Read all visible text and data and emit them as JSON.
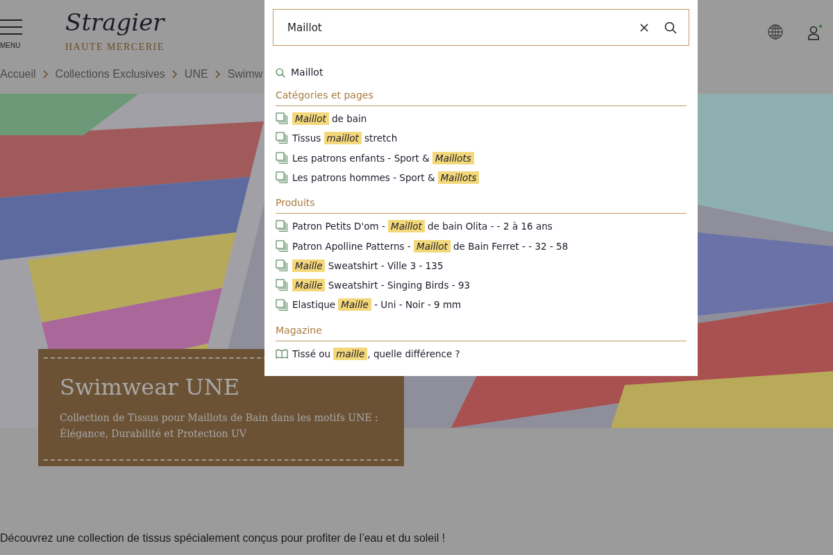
{
  "header": {
    "menu_label": "MENU",
    "logo": {
      "name": "Stragier",
      "tagline": "HAUTE MERCERIE"
    }
  },
  "breadcrumb": [
    "Accueil",
    "Collections Exclusives",
    "UNE",
    "Swimw"
  ],
  "hero": {
    "kind": "picture",
    "title": "Swimwear UNE",
    "subtitle": "Collection de Tissus pour Maillots de Bain dans les motifs UNE : Élégance, Durabilité et Protection UV"
  },
  "intro": "Découvrez une collection de tissus spécialement conçus pour profiter de l’eau et du soleil !",
  "search": {
    "value": "Maillot",
    "suggestion": "Maillot",
    "sections": [
      {
        "title": "Catégories et pages",
        "kind": "pages",
        "items": [
          "*Maillot* de bain",
          "Tissus *maillot* stretch",
          "Les patrons enfants - Sport & *Maillots*",
          "Les patrons hommes - Sport & *Maillots*"
        ]
      },
      {
        "title": "Produits",
        "kind": "pages",
        "items": [
          "Patron Petits D'om - *Maillot* de bain Olita - - 2 à 16 ans",
          "Patron Apolline Patterns - *Maillot* de Bain Ferret - - 32 - 58",
          "*Maille* Sweatshirt - Ville 3 - 135",
          "*Maille* Sweatshirt - Singing Birds - 93",
          "Elastique *Maille* - Uni - Noir - 9 mm"
        ]
      },
      {
        "title": "Magazine",
        "kind": "article",
        "items": [
          "Tissé ou *maille*, quelle différence ?"
        ]
      }
    ]
  }
}
